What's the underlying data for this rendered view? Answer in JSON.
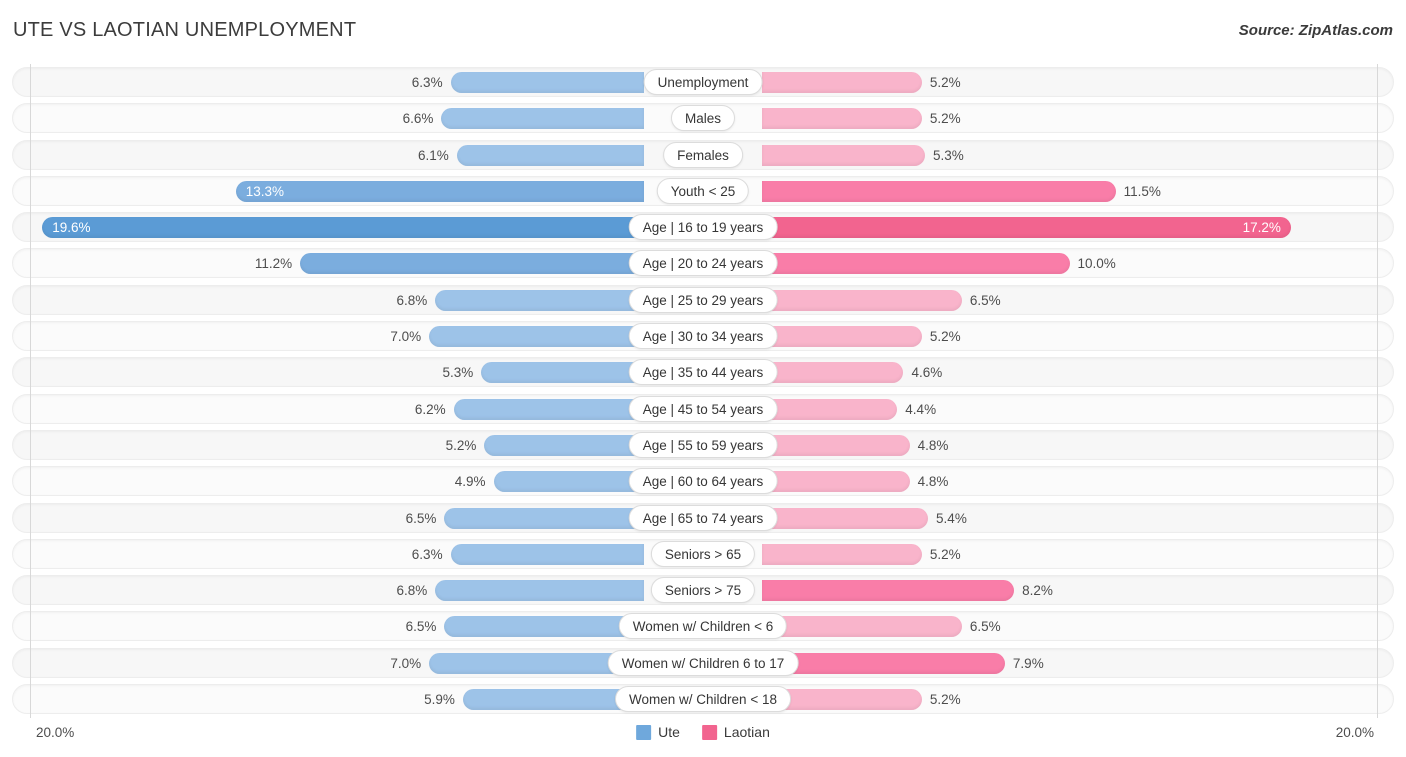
{
  "header": {
    "title": "UTE VS LAOTIAN UNEMPLOYMENT",
    "source": "Source: ZipAtlas.com"
  },
  "legend": {
    "items": [
      {
        "label": "Ute",
        "color": "#6fa8dc"
      },
      {
        "label": "Laotian",
        "color": "#f2648f"
      }
    ]
  },
  "axis": {
    "left_tick": "20.0%",
    "right_tick": "20.0%"
  },
  "colors": {
    "ute_light": "#9dc3e8",
    "ute_mid": "#7badde",
    "ute_dark": "#5b9bd5",
    "laotian_light": "#f9b4cb",
    "laotian_mid": "#f97da8",
    "laotian_dark": "#f2648f",
    "track": "#f7f7f7",
    "axis_line": "#d8d8d8"
  },
  "chart_data": {
    "type": "bar",
    "subtype": "diverging-bidirectional",
    "title": "UTE VS LAOTIAN UNEMPLOYMENT",
    "xlabel": "",
    "ylabel": "",
    "xlim": [
      0,
      20
    ],
    "axis_max_percent": 20.0,
    "unit": "%",
    "grid": false,
    "legend_position": "bottom-center",
    "categories": [
      "Unemployment",
      "Males",
      "Females",
      "Youth < 25",
      "Age | 16 to 19 years",
      "Age | 20 to 24 years",
      "Age | 25 to 29 years",
      "Age | 30 to 34 years",
      "Age | 35 to 44 years",
      "Age | 45 to 54 years",
      "Age | 55 to 59 years",
      "Age | 60 to 64 years",
      "Age | 65 to 74 years",
      "Seniors > 65",
      "Seniors > 75",
      "Women w/ Children < 6",
      "Women w/ Children 6 to 17",
      "Women w/ Children < 18"
    ],
    "series": [
      {
        "name": "Ute",
        "side": "left",
        "color": "#9dc3e8",
        "values": [
          6.3,
          6.6,
          6.1,
          13.3,
          19.6,
          11.2,
          6.8,
          7.0,
          5.3,
          6.2,
          5.2,
          4.9,
          6.5,
          6.3,
          6.8,
          6.5,
          7.0,
          5.9
        ]
      },
      {
        "name": "Laotian",
        "side": "right",
        "color": "#f9b4cb",
        "values": [
          5.2,
          5.2,
          5.3,
          11.5,
          17.2,
          10.0,
          6.5,
          5.2,
          4.6,
          4.4,
          4.8,
          4.8,
          5.4,
          5.2,
          8.2,
          6.5,
          7.9,
          5.2
        ]
      }
    ],
    "rows": [
      {
        "label": "Unemployment",
        "left_value": 6.3,
        "left_text": "6.3%",
        "right_value": 5.2,
        "right_text": "5.2%",
        "left_shade": "light",
        "right_shade": "light",
        "left_inside": false,
        "right_inside": false
      },
      {
        "label": "Males",
        "left_value": 6.6,
        "left_text": "6.6%",
        "right_value": 5.2,
        "right_text": "5.2%",
        "left_shade": "light",
        "right_shade": "light",
        "left_inside": false,
        "right_inside": false
      },
      {
        "label": "Females",
        "left_value": 6.1,
        "left_text": "6.1%",
        "right_value": 5.3,
        "right_text": "5.3%",
        "left_shade": "light",
        "right_shade": "light",
        "left_inside": false,
        "right_inside": false
      },
      {
        "label": "Youth < 25",
        "left_value": 13.3,
        "left_text": "13.3%",
        "right_value": 11.5,
        "right_text": "11.5%",
        "left_shade": "mid",
        "right_shade": "mid",
        "left_inside": true,
        "right_inside": false
      },
      {
        "label": "Age | 16 to 19 years",
        "left_value": 19.6,
        "left_text": "19.6%",
        "right_value": 17.2,
        "right_text": "17.2%",
        "left_shade": "dark",
        "right_shade": "dark",
        "left_inside": true,
        "right_inside": true
      },
      {
        "label": "Age | 20 to 24 years",
        "left_value": 11.2,
        "left_text": "11.2%",
        "right_value": 10.0,
        "right_text": "10.0%",
        "left_shade": "mid",
        "right_shade": "mid",
        "left_inside": false,
        "right_inside": false
      },
      {
        "label": "Age | 25 to 29 years",
        "left_value": 6.8,
        "left_text": "6.8%",
        "right_value": 6.5,
        "right_text": "6.5%",
        "left_shade": "light",
        "right_shade": "light",
        "left_inside": false,
        "right_inside": false
      },
      {
        "label": "Age | 30 to 34 years",
        "left_value": 7.0,
        "left_text": "7.0%",
        "right_value": 5.2,
        "right_text": "5.2%",
        "left_shade": "light",
        "right_shade": "light",
        "left_inside": false,
        "right_inside": false
      },
      {
        "label": "Age | 35 to 44 years",
        "left_value": 5.3,
        "left_text": "5.3%",
        "right_value": 4.6,
        "right_text": "4.6%",
        "left_shade": "light",
        "right_shade": "light",
        "left_inside": false,
        "right_inside": false
      },
      {
        "label": "Age | 45 to 54 years",
        "left_value": 6.2,
        "left_text": "6.2%",
        "right_value": 4.4,
        "right_text": "4.4%",
        "left_shade": "light",
        "right_shade": "light",
        "left_inside": false,
        "right_inside": false
      },
      {
        "label": "Age | 55 to 59 years",
        "left_value": 5.2,
        "left_text": "5.2%",
        "right_value": 4.8,
        "right_text": "4.8%",
        "left_shade": "light",
        "right_shade": "light",
        "left_inside": false,
        "right_inside": false
      },
      {
        "label": "Age | 60 to 64 years",
        "left_value": 4.9,
        "left_text": "4.9%",
        "right_value": 4.8,
        "right_text": "4.8%",
        "left_shade": "light",
        "right_shade": "light",
        "left_inside": false,
        "right_inside": false
      },
      {
        "label": "Age | 65 to 74 years",
        "left_value": 6.5,
        "left_text": "6.5%",
        "right_value": 5.4,
        "right_text": "5.4%",
        "left_shade": "light",
        "right_shade": "light",
        "left_inside": false,
        "right_inside": false
      },
      {
        "label": "Seniors > 65",
        "left_value": 6.3,
        "left_text": "6.3%",
        "right_value": 5.2,
        "right_text": "5.2%",
        "left_shade": "light",
        "right_shade": "light",
        "left_inside": false,
        "right_inside": false
      },
      {
        "label": "Seniors > 75",
        "left_value": 6.8,
        "left_text": "6.8%",
        "right_value": 8.2,
        "right_text": "8.2%",
        "left_shade": "light",
        "right_shade": "mid",
        "left_inside": false,
        "right_inside": false
      },
      {
        "label": "Women w/ Children < 6",
        "left_value": 6.5,
        "left_text": "6.5%",
        "right_value": 6.5,
        "right_text": "6.5%",
        "left_shade": "light",
        "right_shade": "light",
        "left_inside": false,
        "right_inside": false
      },
      {
        "label": "Women w/ Children 6 to 17",
        "left_value": 7.0,
        "left_text": "7.0%",
        "right_value": 7.9,
        "right_text": "7.9%",
        "left_shade": "light",
        "right_shade": "mid",
        "left_inside": false,
        "right_inside": false
      },
      {
        "label": "Women w/ Children < 18",
        "left_value": 5.9,
        "left_text": "5.9%",
        "right_value": 5.2,
        "right_text": "5.2%",
        "left_shade": "light",
        "right_shade": "light",
        "left_inside": false,
        "right_inside": false
      }
    ]
  }
}
